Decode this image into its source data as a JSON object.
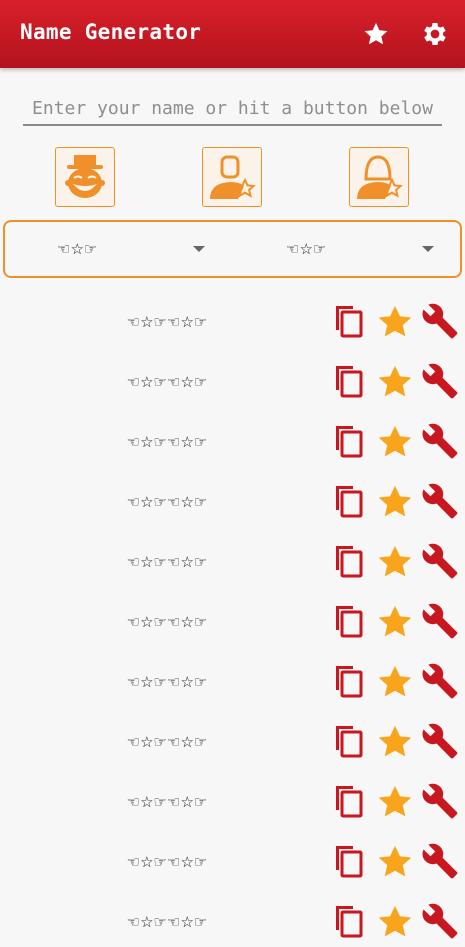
{
  "app": {
    "title": "Name Generator"
  },
  "toolbar": {
    "favorites_icon": "star-icon",
    "settings_icon": "gear-icon"
  },
  "search": {
    "placeholder": "Enter your name or hit a button below",
    "value": ""
  },
  "generator_buttons": [
    {
      "icon": "jester-face-icon"
    },
    {
      "icon": "male-user-star-icon"
    },
    {
      "icon": "female-user-star-icon"
    }
  ],
  "style_selectors": {
    "left_value": "☜☆☞",
    "right_value": "☜☆☞"
  },
  "results": [
    {
      "name": "☜☆☞☜☆☞"
    },
    {
      "name": "☜☆☞☜☆☞"
    },
    {
      "name": "☜☆☞☜☆☞"
    },
    {
      "name": "☜☆☞☜☆☞"
    },
    {
      "name": "☜☆☞☜☆☞"
    },
    {
      "name": "☜☆☞☜☆☞"
    },
    {
      "name": "☜☆☞☜☆☞"
    },
    {
      "name": "☜☆☞☜☆☞"
    },
    {
      "name": "☜☆☞☜☆☞"
    },
    {
      "name": "☜☆☞☜☆☞"
    },
    {
      "name": "☜☆☞☜☆☞"
    }
  ],
  "colors": {
    "primary": "#c8171f",
    "accent": "#f0902a",
    "star": "#f8a51c",
    "background": "#f7f7f7"
  }
}
